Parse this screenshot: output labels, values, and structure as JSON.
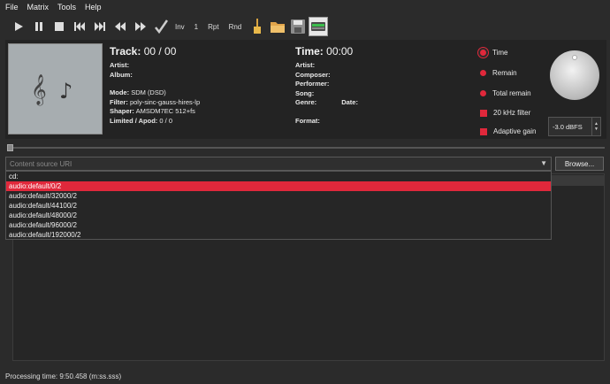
{
  "menu": [
    "File",
    "Matrix",
    "Tools",
    "Help"
  ],
  "toolbar": {
    "inv": "Inv",
    "one": "1",
    "rpt": "Rpt",
    "rnd": "Rnd"
  },
  "track": {
    "label": "Track:",
    "value": "00 / 00"
  },
  "left_fields": {
    "artist": "Artist:",
    "album": "Album:",
    "mode_label": "Mode:",
    "mode_value": "SDM (DSD)",
    "filter_label": "Filter:",
    "filter_value": "poly-sinc-gauss-hires-lp",
    "shaper_label": "Shaper:",
    "shaper_value": "AMSDM7EC 512+fs",
    "limited_label": "Limited / Apod:",
    "limited_value": "0 / 0"
  },
  "time": {
    "label": "Time:",
    "value": "00:00"
  },
  "right_fields": {
    "artist": "Artist:",
    "composer": "Composer:",
    "performer": "Performer:",
    "song": "Song:",
    "genre": "Genre:",
    "date": "Date:",
    "format": "Format:"
  },
  "options": {
    "time": "Time",
    "remain": "Remain",
    "total_remain": "Total remain",
    "filter20k": "20 kHz filter",
    "adaptive_gain": "Adaptive gain"
  },
  "gain_value": "-3.0 dBFS",
  "uri": {
    "placeholder": "Content source URI",
    "browse": "Browse..."
  },
  "dropdown_items": [
    "cd:",
    "audio:default/0/2",
    "audio:default/32000/2",
    "audio:default/44100/2",
    "audio:default/48000/2",
    "audio:default/96000/2",
    "audio:default/192000/2"
  ],
  "selected_index": 1,
  "status": "Processing time: 9:50.458 (m:ss.sss)",
  "colors": {
    "accent": "#e0283b",
    "background": "#2b2b2b"
  }
}
